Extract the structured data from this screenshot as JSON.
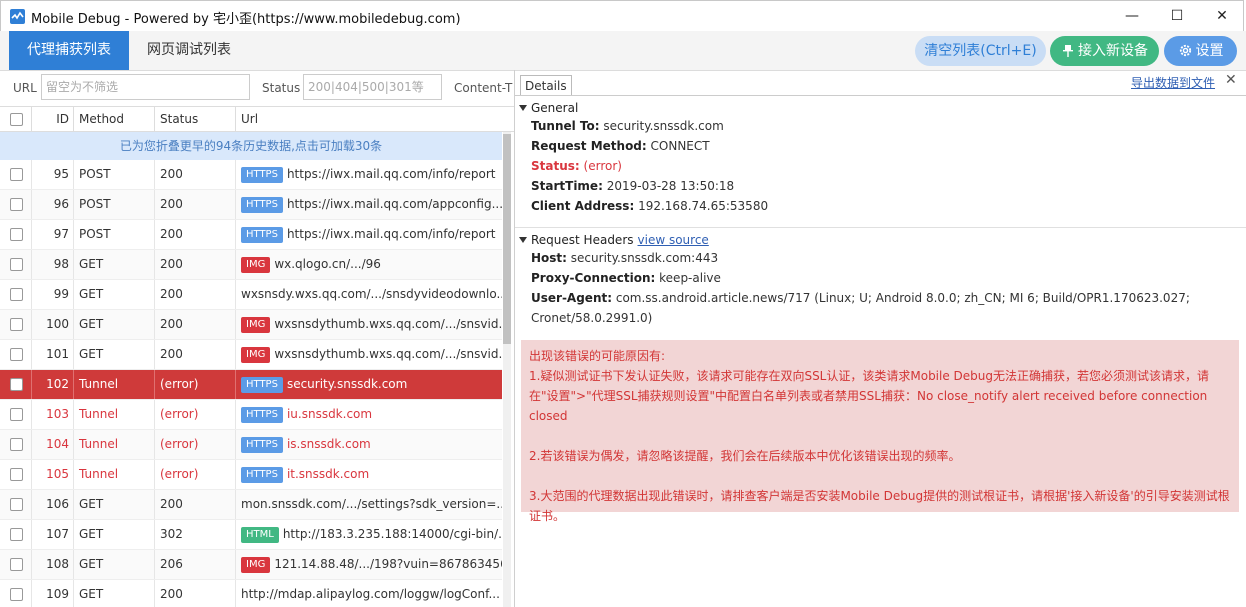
{
  "window": {
    "title": "Mobile Debug - Powered by 宅小歪(https://www.mobiledebug.com)",
    "minimize": "—",
    "maximize": "☐",
    "close": "✕"
  },
  "toolbar": {
    "tab_active": "代理捕获列表",
    "tab_inactive": "网页调试列表",
    "clear_label": "清空列表(Ctrl+E)",
    "connect_label": "接入新设备",
    "settings_label": "设置"
  },
  "filters": {
    "url_label": "URL",
    "url_placeholder": "留空为不筛选",
    "status_label": "Status",
    "status_placeholder": "200|404|500|301等",
    "content_label": "Content-T"
  },
  "table": {
    "headers": [
      "ID",
      "Method",
      "Status",
      "Url"
    ],
    "notice": "已为您折叠更早的94条历史数据,点击可加载30条",
    "rows": [
      {
        "id": "95",
        "method": "POST",
        "status": "200",
        "badge": "HTTPS",
        "url": "https://iwx.mail.qq.com/info/report"
      },
      {
        "id": "96",
        "method": "POST",
        "status": "200",
        "badge": "HTTPS",
        "url": "https://iwx.mail.qq.com/appconfig..."
      },
      {
        "id": "97",
        "method": "POST",
        "status": "200",
        "badge": "HTTPS",
        "url": "https://iwx.mail.qq.com/info/report"
      },
      {
        "id": "98",
        "method": "GET",
        "status": "200",
        "badge": "IMG",
        "url": "wx.qlogo.cn/.../96"
      },
      {
        "id": "99",
        "method": "GET",
        "status": "200",
        "badge": "",
        "url": "wxsnsdy.wxs.qq.com/.../snsdyvideodownlo..."
      },
      {
        "id": "100",
        "method": "GET",
        "status": "200",
        "badge": "IMG",
        "url": "wxsnsdythumb.wxs.qq.com/.../snsvid..."
      },
      {
        "id": "101",
        "method": "GET",
        "status": "200",
        "badge": "IMG",
        "url": "wxsnsdythumb.wxs.qq.com/.../snsvid..."
      },
      {
        "id": "102",
        "method": "Tunnel",
        "status": "(error)",
        "badge": "HTTPS",
        "url": "security.snssdk.com"
      },
      {
        "id": "103",
        "method": "Tunnel",
        "status": "(error)",
        "badge": "HTTPS",
        "url": "iu.snssdk.com"
      },
      {
        "id": "104",
        "method": "Tunnel",
        "status": "(error)",
        "badge": "HTTPS",
        "url": "is.snssdk.com"
      },
      {
        "id": "105",
        "method": "Tunnel",
        "status": "(error)",
        "badge": "HTTPS",
        "url": "it.snssdk.com"
      },
      {
        "id": "106",
        "method": "GET",
        "status": "200",
        "badge": "",
        "url": "mon.snssdk.com/.../settings?sdk_version=..."
      },
      {
        "id": "107",
        "method": "GET",
        "status": "302",
        "badge": "HTML",
        "url": "http://183.3.235.188:14000/cgi-bin/..."
      },
      {
        "id": "108",
        "method": "GET",
        "status": "206",
        "badge": "IMG",
        "url": "121.14.88.48/.../198?vuin=867863456..."
      },
      {
        "id": "109",
        "method": "GET",
        "status": "200",
        "badge": "",
        "url": "http://mdap.alipaylog.com/loggw/logConf..."
      }
    ]
  },
  "details": {
    "tab_label": "Details",
    "export_label": "导出数据到文件",
    "close": "✕",
    "general": {
      "heading": "General",
      "tunnel_to_key": "Tunnel To:",
      "tunnel_to_val": "security.snssdk.com",
      "method_key": "Request Method:",
      "method_val": "CONNECT",
      "status_key": "Status:",
      "status_val": "(error)",
      "start_key": "StartTime:",
      "start_val": "2019-03-28 13:50:18",
      "client_key": "Client Address:",
      "client_val": "192.168.74.65:53580"
    },
    "request_headers": {
      "heading": "Request Headers",
      "view_source": "view source",
      "host_key": "Host:",
      "host_val": "security.snssdk.com:443",
      "proxy_key": "Proxy-Connection:",
      "proxy_val": "keep-alive",
      "ua_key": "User-Agent:",
      "ua_val": "com.ss.android.article.news/717 (Linux; U; Android 8.0.0; zh_CN; MI 6; Build/OPR1.170623.027;",
      "ua_val2": "Cronet/58.0.2991.0)"
    },
    "error": {
      "title": "出现该错误的可能原因有:",
      "line1": "1.疑似测试证书下发认证失败，该请求可能存在双向SSL认证，该类请求Mobile Debug无法正确捕获，若您必须测试该请求，请",
      "line1b": "在\"设置\">\"代理SSL捕获规则设置\"中配置白名单列表或者禁用SSL捕获：No close_notify alert received before connection closed",
      "line2": "2.若该错误为偶发，请忽略该提醒，我们会在后续版本中优化该错误出现的频率。",
      "line3": "3.大范围的代理数据出现此错误时，请排查客户端是否安装Mobile Debug提供的测试根证书，请根据'接入新设备'的引导安装测试根",
      "line3b": "证书。"
    }
  },
  "colors": {
    "accent": "#2f7fd6",
    "selected_row": "#cf3a3a",
    "error_text": "#d9363e",
    "connect_green": "#41b883"
  }
}
